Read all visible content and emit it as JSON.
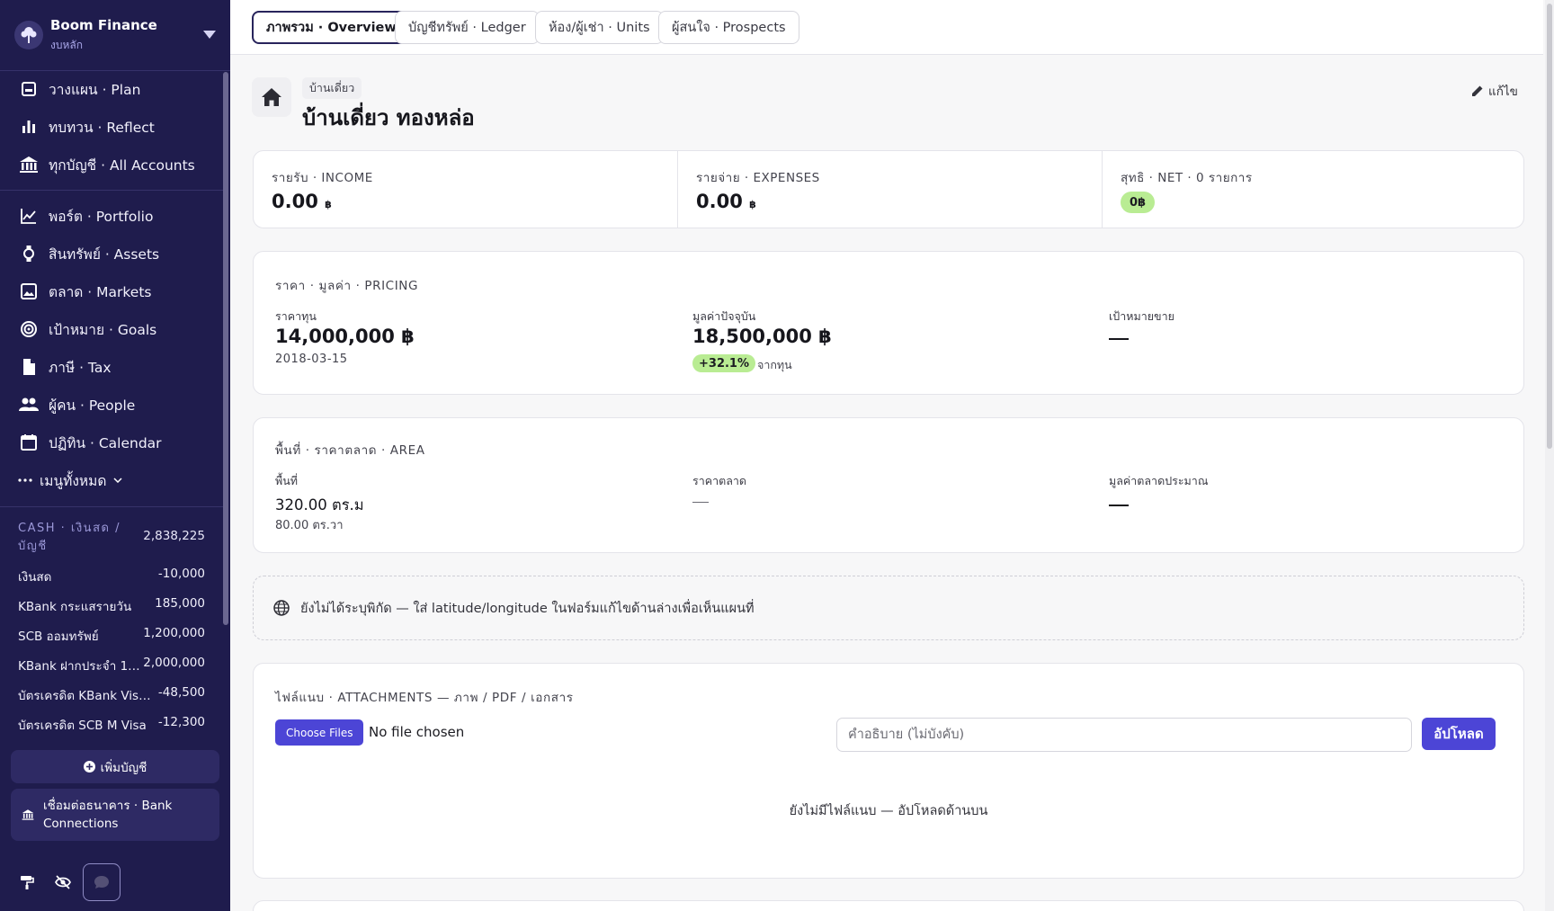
{
  "brand": {
    "name": "Boom Finance",
    "sub": "งบหลัก"
  },
  "nav": [
    {
      "label": "วางแผน · Plan",
      "icon": "plan-icon"
    },
    {
      "label": "ทบทวน · Reflect",
      "icon": "bar-chart-icon"
    },
    {
      "label": "ทุกบัญชี · All Accounts",
      "icon": "bank-icon"
    },
    {
      "label": "พอร์ต · Portfolio",
      "icon": "line-chart-icon"
    },
    {
      "label": "สินทรัพย์ · Assets",
      "icon": "watch-icon"
    },
    {
      "label": "ตลาด · Markets",
      "icon": "image-icon"
    },
    {
      "label": "เป้าหมาย · Goals",
      "icon": "target-icon"
    },
    {
      "label": "ภาษี · Tax",
      "icon": "document-icon"
    },
    {
      "label": "ผู้คน · People",
      "icon": "people-icon"
    },
    {
      "label": "ปฏิทิน · Calendar",
      "icon": "calendar-icon"
    },
    {
      "label": "เมนูทั้งหมด",
      "icon": "more-icon"
    }
  ],
  "accounts": {
    "header": "CASH · เงินสด / บัญชี",
    "header_total": "2,838,225",
    "items": [
      {
        "name": "เงินสด",
        "amount": "-10,000"
      },
      {
        "name": "KBank กระแสรายวัน",
        "amount": "185,000"
      },
      {
        "name": "SCB ออมทรัพย์",
        "amount": "1,200,000"
      },
      {
        "name": "KBank ฝากประจำ 12 เ...",
        "amount": "2,000,000"
      },
      {
        "name": "บัตรเครดิต KBank Visa ...",
        "amount": "-48,500"
      },
      {
        "name": "บัตรเครดิต SCB M Visa",
        "amount": "-12,300"
      }
    ],
    "add_label": "เพิ่มบัญชี",
    "bank_label": "เชื่อมต่อธนาคาร · Bank Connections"
  },
  "tabs": [
    {
      "label": "ภาพรวม · Overview",
      "active": true
    },
    {
      "label": "บัญชีทรัพย์ · Ledger",
      "active": false
    },
    {
      "label": "ห้อง/ผู้เช่า · Units",
      "active": false
    },
    {
      "label": "ผู้สนใจ · Prospects",
      "active": false
    }
  ],
  "page": {
    "breadcrumb": "บ้านเดี่ยว",
    "title": "บ้านเดี่ยว ทองหล่อ",
    "edit_label": "แก้ไข"
  },
  "summary": {
    "income_label": "รายรับ · INCOME",
    "income_value": "0.00",
    "expenses_label": "รายจ่าย · EXPENSES",
    "expenses_value": "0.00",
    "currency": "฿",
    "net_label": "สุทธิ · NET · 0 รายการ",
    "net_value": "0฿"
  },
  "pricing": {
    "section": "ราคา · มูลค่า · PRICING",
    "cost_label": "ราคาทุน",
    "cost_value": "14,000,000 ฿",
    "cost_date": "2018-03-15",
    "current_label": "มูลค่าปัจจุบัน",
    "current_value": "18,500,000 ฿",
    "change_pct": "+32.1%",
    "change_suffix": "จากทุน",
    "target_label": "เป้าหมายขาย",
    "target_value": "—"
  },
  "area": {
    "section": "พื้นที่ · ราคาตลาด · AREA",
    "area_label": "พื้นที่",
    "area_sqm": "320.00 ตร.ม",
    "area_sqwa": "80.00 ตร.วา",
    "market_price_label": "ราคาตลาด",
    "market_price_value": "—",
    "est_value_label": "มูลค่าตลาดประมาณ",
    "est_value": "—"
  },
  "map_notice": "ยังไม่ได้ระบุพิกัด — ใส่ latitude/longitude ในฟอร์มแก้ไขด้านล่างเพื่อเห็นแผนที่",
  "attachments": {
    "section": "ไฟล์แนบ · ATTACHMENTS — ภาพ / PDF / เอกสาร",
    "choose_label": "Choose Files",
    "no_file": "No file chosen",
    "desc_placeholder": "คำอธิบาย (ไม่บังคับ)",
    "upload_label": "อัปโหลด",
    "empty": "ยังไม่มีไฟล์แนบ — อัปโหลดด้านบน"
  },
  "colors": {
    "sidebar": "#1f1c4d",
    "accent": "#4c45d6",
    "positive": "#b9ec93"
  }
}
